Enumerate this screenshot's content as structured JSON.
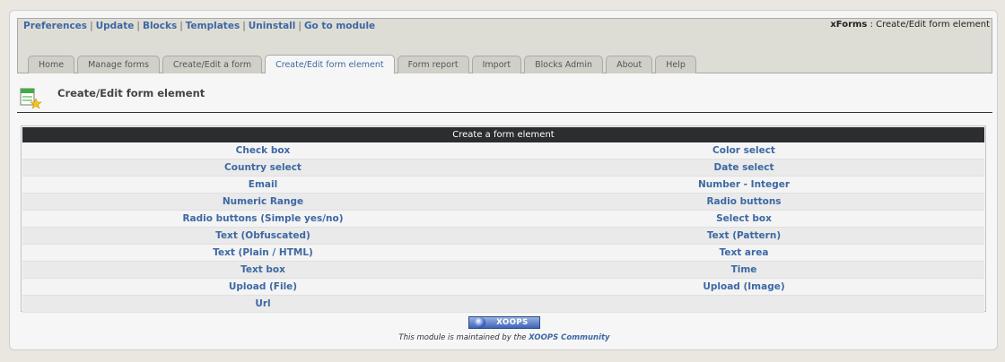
{
  "header": {
    "nav": [
      "Preferences",
      "Update",
      "Blocks",
      "Templates",
      "Uninstall",
      "Go to module"
    ],
    "module": "xForms",
    "crumb_sep": " : ",
    "crumb_page": "Create/Edit form element"
  },
  "tabs": [
    {
      "label": "Home",
      "active": false
    },
    {
      "label": "Manage forms",
      "active": false
    },
    {
      "label": "Create/Edit a form",
      "active": false
    },
    {
      "label": "Create/Edit form element",
      "active": true
    },
    {
      "label": "Form report",
      "active": false
    },
    {
      "label": "Import",
      "active": false
    },
    {
      "label": "Blocks Admin",
      "active": false
    },
    {
      "label": "About",
      "active": false
    },
    {
      "label": "Help",
      "active": false
    }
  ],
  "page": {
    "title": "Create/Edit form element"
  },
  "table": {
    "header": "Create a form element",
    "rows": [
      [
        "Check box",
        "Color select"
      ],
      [
        "Country select",
        "Date select"
      ],
      [
        "Email",
        "Number - Integer"
      ],
      [
        "Numeric Range",
        "Radio buttons"
      ],
      [
        "Radio buttons (Simple yes/no)",
        "Select box"
      ],
      [
        "Text (Obfuscated)",
        "Text (Pattern)"
      ],
      [
        "Text (Plain / HTML)",
        "Text area"
      ],
      [
        "Text box",
        "Time"
      ],
      [
        "Upload (File)",
        "Upload (Image)"
      ],
      [
        "Url",
        ""
      ]
    ]
  },
  "footer": {
    "badge": "XOOPS",
    "maintained_prefix": "This module is maintained by the ",
    "community": "XOOPS Community"
  },
  "colors": {
    "link": "#3d68a3",
    "table_header": "#2b2d2f"
  },
  "icons": {
    "page": "form-element-add-icon",
    "badge": "globe-icon"
  }
}
